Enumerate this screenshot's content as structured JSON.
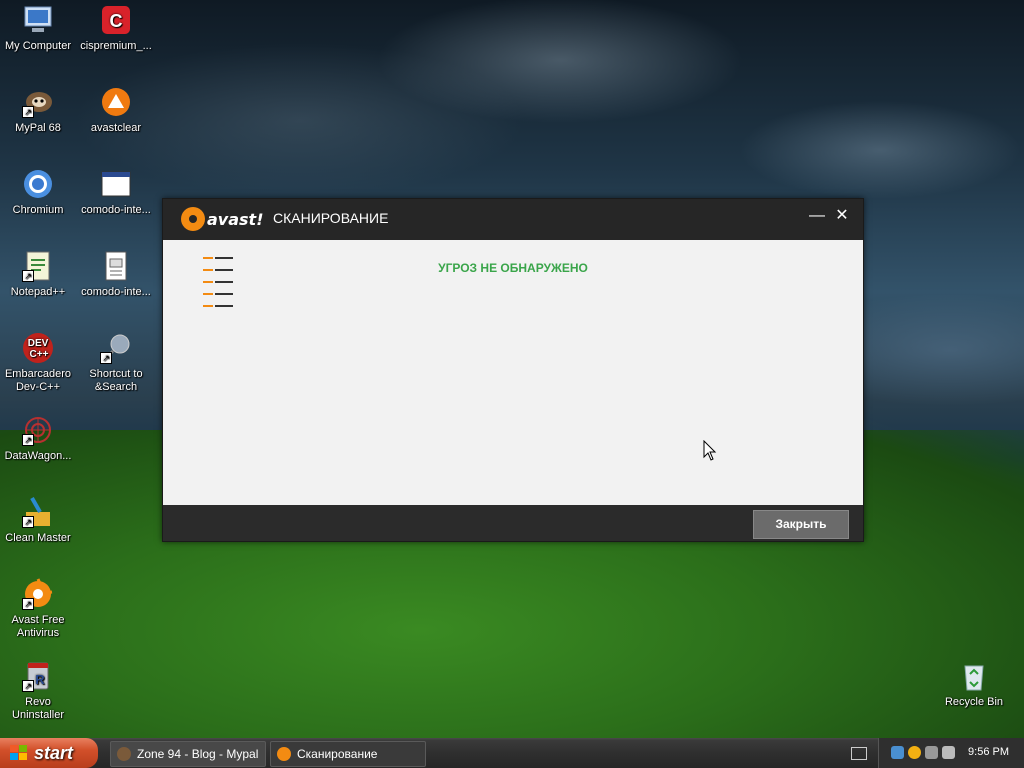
{
  "desktop": {
    "icons": [
      {
        "label": "My Computer",
        "icon": "computer-icon"
      },
      {
        "label": "cispremium_...",
        "icon": "comodo-icon"
      },
      {
        "label": "MyPal 68",
        "icon": "mypal-icon"
      },
      {
        "label": "avastclear",
        "icon": "avastclear-icon"
      },
      {
        "label": "Chromium",
        "icon": "chromium-icon"
      },
      {
        "label": "comodo-inte...",
        "icon": "window-icon"
      },
      {
        "label": "Notepad++",
        "icon": "notepad-icon"
      },
      {
        "label": "comodo-inte...",
        "icon": "text-file-icon"
      },
      {
        "label": "Embarcadero Dev-C++",
        "icon": "devcpp-icon"
      },
      {
        "label": "Shortcut to &Search",
        "icon": "search-icon"
      },
      {
        "label": "DataWagon...",
        "icon": "datawagon-icon"
      },
      {
        "label": "Clean Master",
        "icon": "broom-icon"
      },
      {
        "label": "Avast Free Antivirus",
        "icon": "avast-icon"
      },
      {
        "label": "Revo Uninstaller",
        "icon": "revo-icon"
      },
      {
        "label": "Recycle Bin",
        "icon": "recycle-bin-icon"
      }
    ]
  },
  "window": {
    "brand": "avast!",
    "title": "СКАНИРОВАНИЕ",
    "minimize_glyph": "—",
    "close_glyph": "✕",
    "status": "УГРОЗ НЕ ОБНАРУЖЕНО",
    "close_button": "Закрыть",
    "colors": {
      "accent": "#f38b12",
      "status": "#3aa54a",
      "titlebar": "#262626"
    }
  },
  "taskbar": {
    "start_label": "start",
    "tasks": [
      {
        "label": "Zone 94 - Blog - Mypal",
        "icon": "mypal-icon"
      },
      {
        "label": "Сканирование",
        "icon": "avast-icon"
      }
    ],
    "clock": "9:56 PM"
  }
}
